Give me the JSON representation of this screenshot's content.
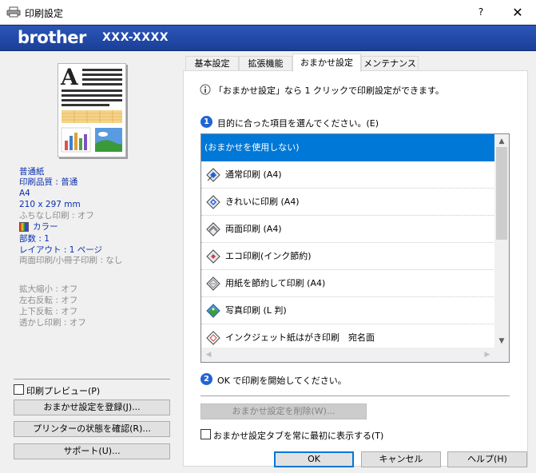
{
  "window": {
    "title": "印刷設定",
    "help_label": "?",
    "close_label": "✕"
  },
  "banner": {
    "brand": "brother",
    "model": "XXX-XXXX"
  },
  "summary": {
    "paper": "普通紙",
    "quality": "印刷品質 : 普通",
    "size": "A4",
    "dimensions": "210 x 297 mm",
    "borderless": "ふちなし印刷 : オフ",
    "color": "カラー",
    "copies": "部数 : 1",
    "layout": "レイアウト : 1 ページ",
    "duplex": "両面印刷/小冊子印刷 : なし",
    "scaling": "拡大縮小 : オフ",
    "mirror": "左右反転 : オフ",
    "reverse": "上下反転 : オフ",
    "watermark": "透かし印刷 : オフ"
  },
  "left_controls": {
    "preview_checkbox_label": "印刷プレビュー(P)",
    "register_button": "おまかせ設定を登録(J)...",
    "status_button": "プリンターの状態を確認(R)...",
    "support_button": "サポート(U)..."
  },
  "tabs": [
    {
      "label": "基本設定",
      "active": false
    },
    {
      "label": "拡張機能",
      "active": false
    },
    {
      "label": "おまかせ設定",
      "active": true
    },
    {
      "label": "メンテナンス",
      "active": false
    }
  ],
  "main": {
    "info_text": "「おまかせ設定」なら 1 クリックで印刷設定ができます。",
    "step1_num": "1",
    "step1_text": "目的に合った項目を選んでください。(E)",
    "step2_num": "2",
    "step2_text": "OK で印刷を開始してください。",
    "delete_button": "おまかせ設定を削除(W)...",
    "always_show_label": "おまかせ設定タブを常に最初に表示する(T)"
  },
  "presets": [
    {
      "label": "(おまかせを使用しない)",
      "selected": true,
      "icon": "none"
    },
    {
      "label": "通常印刷 (A4)",
      "selected": false,
      "icon": "printer-preset-icon"
    },
    {
      "label": "きれいに印刷 (A4)",
      "selected": false,
      "icon": "printer-preset-icon"
    },
    {
      "label": "両面印刷 (A4)",
      "selected": false,
      "icon": "printer-preset-icon"
    },
    {
      "label": "エコ印刷(インク節約)",
      "selected": false,
      "icon": "printer-preset-icon"
    },
    {
      "label": "用紙を節約して印刷 (A4)",
      "selected": false,
      "icon": "printer-preset-icon"
    },
    {
      "label": "写真印刷 (L 判)",
      "selected": false,
      "icon": "photo-preset-icon"
    },
    {
      "label": "インクジェット紙はがき印刷　宛名面",
      "selected": false,
      "icon": "postcard-preset-icon"
    }
  ],
  "footer": {
    "ok": "OK",
    "cancel": "キャンセル",
    "help": "ヘルプ(H)"
  },
  "colors": {
    "banner": "#2249a8",
    "selection": "#0078d7",
    "summary_text": "#0a2fb0",
    "disabled_text": "#8c8c8c",
    "step_circle": "#1f64d4"
  }
}
